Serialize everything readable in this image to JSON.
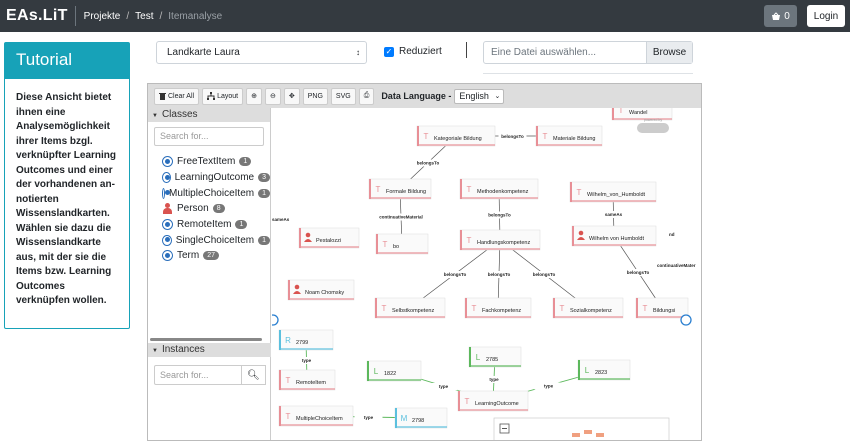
{
  "nav": {
    "brand": "EAs.LiT",
    "crumbs": [
      "Projekte",
      "Test",
      "Itemanalyse"
    ],
    "cart_count": "0",
    "login_label": "Login"
  },
  "tutorial": {
    "title": "Tutorial",
    "text": "Diese Ansicht bietet ihnen eine Analysemöglichkeit ihrer Items bzgl. verknüpfter Learning Outcomes und einer der vorhandenen an-notierten Wissenslandkarten. Wählen sie dazu die Wissenslandkarte aus, mit der sie die Items bzw. Learning Outcomes verknüpfen wollen."
  },
  "controls": {
    "map_selected": "Landkarte Laura",
    "reduziert_label": "Reduziert",
    "file_placeholder": "Eine Datei auswählen...",
    "browse_label": "Browse"
  },
  "toolbar": {
    "clear_all": "Clear All",
    "layout": "Layout",
    "png": "PNG",
    "svg": "SVG",
    "data_language_label": "Data Language -",
    "language": "English"
  },
  "sidebar": {
    "classes_title": "Classes",
    "search_placeholder": "Search for...",
    "classes": [
      {
        "name": "FreeTextItem",
        "count": "1",
        "icon": "radio"
      },
      {
        "name": "LearningOutcome",
        "count": "3",
        "icon": "radio"
      },
      {
        "name": "MultipleChoiceItem",
        "count": "1",
        "icon": "radio"
      },
      {
        "name": "Person",
        "count": "8",
        "icon": "person-icon"
      },
      {
        "name": "RemoteItem",
        "count": "1",
        "icon": "radio"
      },
      {
        "name": "SingleChoiceItem",
        "count": "1",
        "icon": "radio"
      },
      {
        "name": "Term",
        "count": "27",
        "icon": "radio"
      }
    ],
    "instances_title": "Instances",
    "instances_placeholder": "Search for..."
  },
  "graph": {
    "colors": {
      "term": "#e88f96",
      "item": "#e88f96",
      "lo": "#5cb85c",
      "mc": "#5bc0de",
      "remote": "#5bc0de"
    },
    "nodes": [
      {
        "id": "wandel",
        "label": "Wandel",
        "kind": "term"
      },
      {
        "id": "kb",
        "label": "Kategoriale Bildung",
        "kind": "term"
      },
      {
        "id": "mb",
        "label": "Materiale Bildung",
        "kind": "term"
      },
      {
        "id": "fb",
        "label": "Formale Bildung",
        "kind": "term"
      },
      {
        "id": "mk",
        "label": "Methodenkompetenz",
        "kind": "term"
      },
      {
        "id": "wvh1",
        "label": "Wilhelm_von_Humboldt",
        "kind": "term"
      },
      {
        "id": "pes",
        "label": "Pestalozzi",
        "kind": "person"
      },
      {
        "id": "bo",
        "label": "bo",
        "kind": "term"
      },
      {
        "id": "hk",
        "label": "Handlungskompetenz",
        "kind": "term"
      },
      {
        "id": "wvh2",
        "label": "Wilhelm von Humboldt",
        "kind": "person"
      },
      {
        "id": "nc",
        "label": "Noam Chomsky",
        "kind": "person"
      },
      {
        "id": "sk",
        "label": "Selbstkompetenz",
        "kind": "term"
      },
      {
        "id": "fk",
        "label": "Fachkompetenz",
        "kind": "term"
      },
      {
        "id": "sok",
        "label": "Sozialkompetenz",
        "kind": "term"
      },
      {
        "id": "bild",
        "label": "Bildungsi",
        "kind": "term"
      },
      {
        "id": "r2799",
        "label": "2799",
        "kind": "remote"
      },
      {
        "id": "l2785",
        "label": "2785",
        "kind": "lo"
      },
      {
        "id": "l1822",
        "label": "1822",
        "kind": "lo"
      },
      {
        "id": "l2823",
        "label": "2823",
        "kind": "lo"
      },
      {
        "id": "ri",
        "label": "RemoteItem",
        "kind": "term"
      },
      {
        "id": "lo",
        "label": "LearningOutcome",
        "kind": "term"
      },
      {
        "id": "mci",
        "label": "MultipleChoiceItem",
        "kind": "term"
      },
      {
        "id": "m2798",
        "label": "2798",
        "kind": "mc"
      }
    ],
    "edges": [
      {
        "from": "kb",
        "to": "mb",
        "label": "belongsTo"
      },
      {
        "from": "kb",
        "to": "fb",
        "label": "belongsTo"
      },
      {
        "from": "fb",
        "to": "bo",
        "label": "continuativeMaterial"
      },
      {
        "from": "mk",
        "to": "hk",
        "label": "belongsTo"
      },
      {
        "from": "wvh1",
        "to": "wvh2",
        "label": "sameAs"
      },
      {
        "from": "hk",
        "to": "sk",
        "label": "belongsTo"
      },
      {
        "from": "hk",
        "to": "fk",
        "label": "belongsTo"
      },
      {
        "from": "hk",
        "to": "sok",
        "label": "belongsTo"
      },
      {
        "from": "wvh2",
        "to": "bild",
        "label": "belongsTo"
      },
      {
        "from": "r2799",
        "to": "ri",
        "label": "type"
      },
      {
        "from": "l2785",
        "to": "lo",
        "label": "type"
      },
      {
        "from": "l1822",
        "to": "lo",
        "label": "type"
      },
      {
        "from": "l2823",
        "to": "lo",
        "label": "type"
      },
      {
        "from": "m2798",
        "to": "mci",
        "label": "type"
      }
    ],
    "stray_labels": [
      "sameAs",
      "continuativeMater",
      "nd"
    ],
    "watermark": "powered by"
  }
}
